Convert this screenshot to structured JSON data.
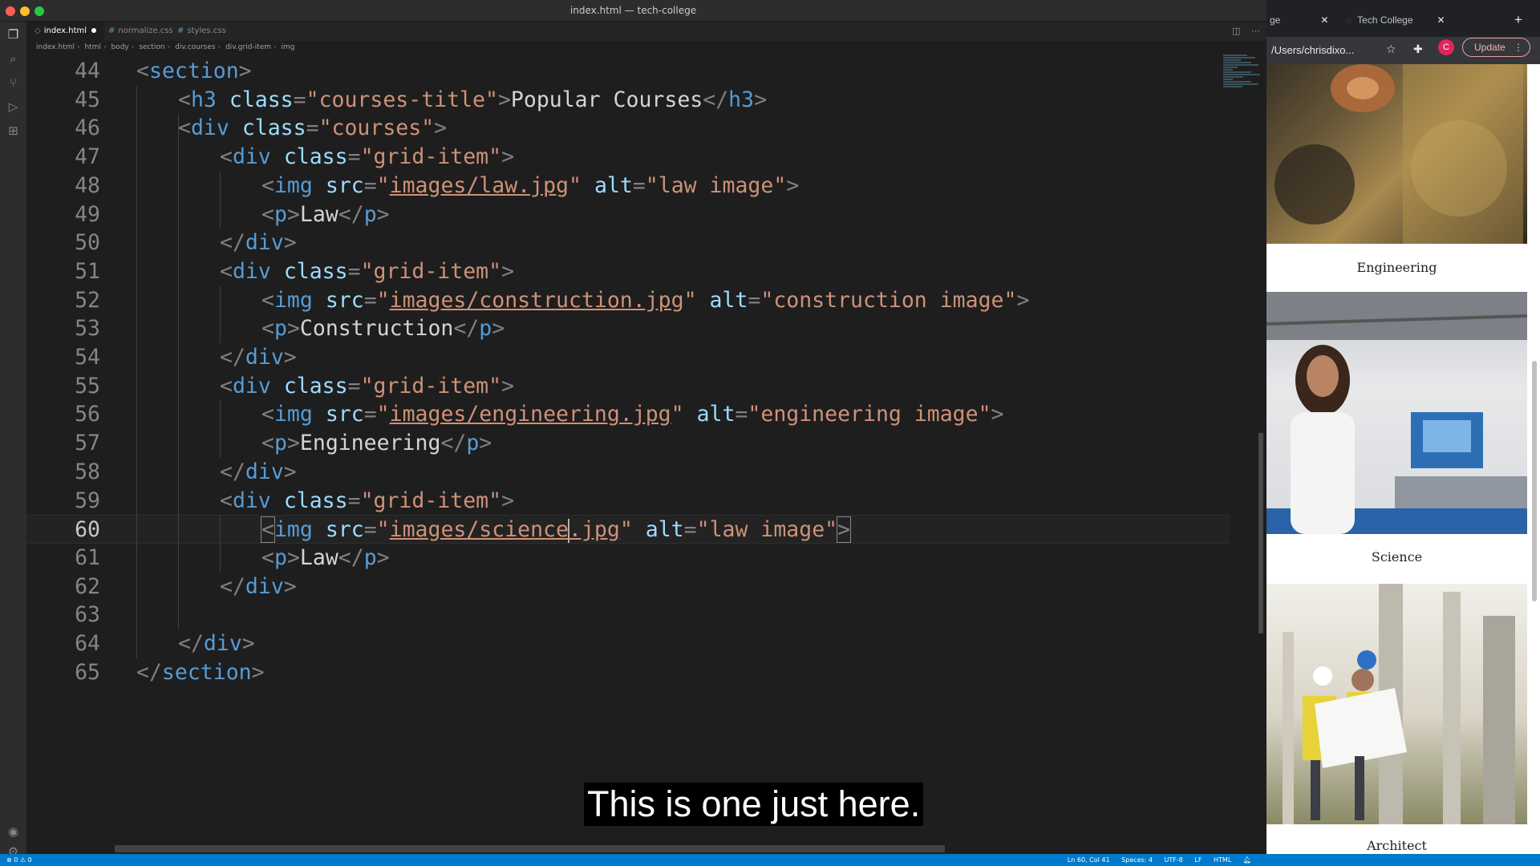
{
  "editor": {
    "window_title": "index.html — tech-college",
    "tabs": [
      {
        "label": "index.html",
        "ext": "◇",
        "active": true,
        "modified": true
      },
      {
        "label": "normalize.css",
        "ext": "#",
        "active": false,
        "modified": false
      },
      {
        "label": "styles.css",
        "ext": "#",
        "active": false,
        "modified": false
      }
    ],
    "breadcrumbs": [
      "index.html",
      "html",
      "body",
      "section",
      "div.courses",
      "div.grid-item",
      "img"
    ],
    "lines": [
      {
        "n": "44",
        "tokens": [
          [
            "p",
            "<"
          ],
          [
            "t",
            "section"
          ],
          [
            "p",
            ">"
          ]
        ]
      },
      {
        "n": "45",
        "tokens": [
          [
            "p",
            "<"
          ],
          [
            "t",
            "h3"
          ],
          [
            "x",
            " "
          ],
          [
            "a",
            "class"
          ],
          [
            "p",
            "="
          ],
          [
            "s",
            "\"courses-title\""
          ],
          [
            "p",
            ">"
          ],
          [
            "x",
            "Popular Courses"
          ],
          [
            "p",
            "</"
          ],
          [
            "t",
            "h3"
          ],
          [
            "p",
            ">"
          ]
        ]
      },
      {
        "n": "46",
        "tokens": [
          [
            "p",
            "<"
          ],
          [
            "t",
            "div"
          ],
          [
            "x",
            " "
          ],
          [
            "a",
            "class"
          ],
          [
            "p",
            "="
          ],
          [
            "s",
            "\"courses\""
          ],
          [
            "p",
            ">"
          ]
        ]
      },
      {
        "n": "47",
        "tokens": [
          [
            "p",
            "<"
          ],
          [
            "t",
            "div"
          ],
          [
            "x",
            " "
          ],
          [
            "a",
            "class"
          ],
          [
            "p",
            "="
          ],
          [
            "s",
            "\"grid-item\""
          ],
          [
            "p",
            ">"
          ]
        ]
      },
      {
        "n": "48",
        "tokens": [
          [
            "p",
            "<"
          ],
          [
            "t",
            "img"
          ],
          [
            "x",
            " "
          ],
          [
            "a",
            "src"
          ],
          [
            "p",
            "="
          ],
          [
            "s",
            "\""
          ],
          [
            "l",
            "images/law.jpg"
          ],
          [
            "s",
            "\""
          ],
          [
            "x",
            " "
          ],
          [
            "a",
            "alt"
          ],
          [
            "p",
            "="
          ],
          [
            "s",
            "\"law image\""
          ],
          [
            "p",
            ">"
          ]
        ]
      },
      {
        "n": "49",
        "tokens": [
          [
            "p",
            "<"
          ],
          [
            "t",
            "p"
          ],
          [
            "p",
            ">"
          ],
          [
            "x",
            "Law"
          ],
          [
            "p",
            "</"
          ],
          [
            "t",
            "p"
          ],
          [
            "p",
            ">"
          ]
        ]
      },
      {
        "n": "50",
        "tokens": [
          [
            "p",
            "</"
          ],
          [
            "t",
            "div"
          ],
          [
            "p",
            ">"
          ]
        ]
      },
      {
        "n": "51",
        "tokens": [
          [
            "p",
            "<"
          ],
          [
            "t",
            "div"
          ],
          [
            "x",
            " "
          ],
          [
            "a",
            "class"
          ],
          [
            "p",
            "="
          ],
          [
            "s",
            "\"grid-item\""
          ],
          [
            "p",
            ">"
          ]
        ]
      },
      {
        "n": "52",
        "tokens": [
          [
            "p",
            "<"
          ],
          [
            "t",
            "img"
          ],
          [
            "x",
            " "
          ],
          [
            "a",
            "src"
          ],
          [
            "p",
            "="
          ],
          [
            "s",
            "\""
          ],
          [
            "l",
            "images/construction.jpg"
          ],
          [
            "s",
            "\""
          ],
          [
            "x",
            " "
          ],
          [
            "a",
            "alt"
          ],
          [
            "p",
            "="
          ],
          [
            "s",
            "\"construction image\""
          ],
          [
            "p",
            ">"
          ]
        ]
      },
      {
        "n": "53",
        "tokens": [
          [
            "p",
            "<"
          ],
          [
            "t",
            "p"
          ],
          [
            "p",
            ">"
          ],
          [
            "x",
            "Construction"
          ],
          [
            "p",
            "</"
          ],
          [
            "t",
            "p"
          ],
          [
            "p",
            ">"
          ]
        ]
      },
      {
        "n": "54",
        "tokens": [
          [
            "p",
            "</"
          ],
          [
            "t",
            "div"
          ],
          [
            "p",
            ">"
          ]
        ]
      },
      {
        "n": "55",
        "tokens": [
          [
            "p",
            "<"
          ],
          [
            "t",
            "div"
          ],
          [
            "x",
            " "
          ],
          [
            "a",
            "class"
          ],
          [
            "p",
            "="
          ],
          [
            "s",
            "\"grid-item\""
          ],
          [
            "p",
            ">"
          ]
        ]
      },
      {
        "n": "56",
        "tokens": [
          [
            "p",
            "<"
          ],
          [
            "t",
            "img"
          ],
          [
            "x",
            " "
          ],
          [
            "a",
            "src"
          ],
          [
            "p",
            "="
          ],
          [
            "s",
            "\""
          ],
          [
            "l",
            "images/engineering.jpg"
          ],
          [
            "s",
            "\""
          ],
          [
            "x",
            " "
          ],
          [
            "a",
            "alt"
          ],
          [
            "p",
            "="
          ],
          [
            "s",
            "\"engineering image\""
          ],
          [
            "p",
            ">"
          ]
        ]
      },
      {
        "n": "57",
        "tokens": [
          [
            "p",
            "<"
          ],
          [
            "t",
            "p"
          ],
          [
            "p",
            ">"
          ],
          [
            "x",
            "Engineering"
          ],
          [
            "p",
            "</"
          ],
          [
            "t",
            "p"
          ],
          [
            "p",
            ">"
          ]
        ]
      },
      {
        "n": "58",
        "tokens": [
          [
            "p",
            "</"
          ],
          [
            "t",
            "div"
          ],
          [
            "p",
            ">"
          ]
        ]
      },
      {
        "n": "59",
        "tokens": [
          [
            "p",
            "<"
          ],
          [
            "t",
            "div"
          ],
          [
            "x",
            " "
          ],
          [
            "a",
            "class"
          ],
          [
            "p",
            "="
          ],
          [
            "s",
            "\"grid-item\""
          ],
          [
            "p",
            ">"
          ]
        ]
      },
      {
        "n": "60",
        "tokens": [
          [
            "pb",
            "<"
          ],
          [
            "t",
            "img"
          ],
          [
            "x",
            " "
          ],
          [
            "a",
            "src"
          ],
          [
            "p",
            "="
          ],
          [
            "s",
            "\""
          ],
          [
            "l",
            "images/science"
          ],
          [
            "c",
            ""
          ],
          [
            "l",
            ".jpg"
          ],
          [
            "s",
            "\""
          ],
          [
            "x",
            " "
          ],
          [
            "a",
            "alt"
          ],
          [
            "p",
            "="
          ],
          [
            "s",
            "\"law image\""
          ],
          [
            "pb",
            ">"
          ]
        ]
      },
      {
        "n": "61",
        "tokens": [
          [
            "p",
            "<"
          ],
          [
            "t",
            "p"
          ],
          [
            "p",
            ">"
          ],
          [
            "x",
            "Law"
          ],
          [
            "p",
            "</"
          ],
          [
            "t",
            "p"
          ],
          [
            "p",
            ">"
          ]
        ]
      },
      {
        "n": "62",
        "tokens": [
          [
            "p",
            "</"
          ],
          [
            "t",
            "div"
          ],
          [
            "p",
            ">"
          ]
        ]
      },
      {
        "n": "63",
        "tokens": []
      },
      {
        "n": "64",
        "tokens": [
          [
            "p",
            "</"
          ],
          [
            "t",
            "div"
          ],
          [
            "p",
            ">"
          ]
        ]
      },
      {
        "n": "65",
        "tokens": [
          [
            "p",
            "</"
          ],
          [
            "t",
            "section"
          ],
          [
            "p",
            ">"
          ]
        ]
      }
    ],
    "status": {
      "left": "⊗ 0 ⚠ 0",
      "position": "Ln 60, Col 41",
      "spaces": "Spaces: 4",
      "encoding": "UTF-8",
      "eol": "LF",
      "language": "HTML"
    }
  },
  "browser": {
    "tabs": [
      {
        "label": "ge"
      },
      {
        "label": "Tech College"
      }
    ],
    "new_tab_icon": "plus-icon",
    "url": "/Users/chrisdixo...",
    "profile_initial": "C",
    "update_label": "Update",
    "courses": [
      {
        "label": "Engineering"
      },
      {
        "label": "Science"
      },
      {
        "label": "Architect"
      }
    ]
  },
  "caption": "This is one just here.",
  "colors": {
    "tag": "#569cd6",
    "attribute": "#9cdcfe",
    "string": "#ce9178",
    "status_bar": "#007acc",
    "editor_bg": "#1e1e1e"
  }
}
